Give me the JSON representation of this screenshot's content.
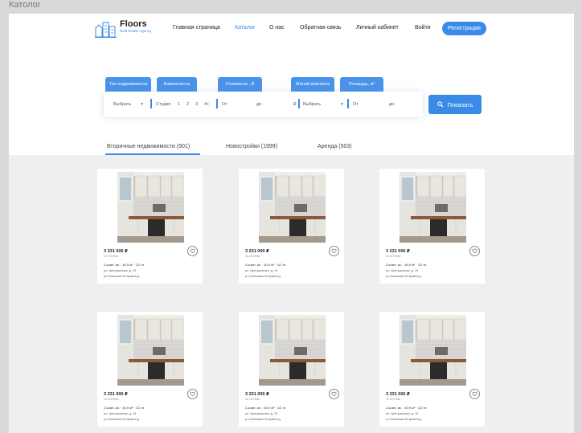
{
  "canvas_label": "Католог",
  "brand": {
    "name": "Floors",
    "tagline": "Real Estate Agency",
    "accent_color": "#3a8be8"
  },
  "nav": {
    "items": [
      "Главная страница",
      "Каталог",
      "О нас",
      "Обратная связь",
      "Личный кабинет",
      "Войти"
    ],
    "active": "Каталог",
    "register_label": "Регистрация"
  },
  "filters": {
    "tabs": [
      "Тип недвижимости",
      "Комнатность",
      "Стоимость , ₽",
      "Жилой комплекс",
      "Площадь, м²"
    ],
    "type_select": "Выбрать",
    "rooms_label": "Студия",
    "rooms_options": [
      "1",
      "2",
      "3",
      "4+"
    ],
    "price_from": "От",
    "price_to": "до",
    "price_unit": "₽",
    "complex_select": "Выбрать",
    "area_from": "От",
    "area_to": "до",
    "submit_label": "Показать"
  },
  "tabs": [
    {
      "label": "Вторичные недвижимости (901)",
      "active": true
    },
    {
      "label": "Новостройки (1999)",
      "active": false
    },
    {
      "label": "Аренда (503)",
      "active": false
    }
  ],
  "listings": [
    {
      "price": "3 231 000 ₽",
      "price_per_m2": "10 223 ₽/м²",
      "rooms": "2-комн. кв.",
      "area": "40,9 м²",
      "floor": "1/2 эт.",
      "address": "ул. Центральная, д. 13",
      "metro": "р-н Большая Островня д."
    },
    {
      "price": "3 231 000 ₽",
      "price_per_m2": "10 223 ₽/м²",
      "rooms": "2-комн. кв.",
      "area": "40,9 м²",
      "floor": "1/2 эт.",
      "address": "ул. Центральная, д. 13",
      "metro": "р-н Большая Островня д."
    },
    {
      "price": "3 231 000 ₽",
      "price_per_m2": "10 223 ₽/м²",
      "rooms": "2-комн. кв.",
      "area": "40,9 м²",
      "floor": "1/2 эт.",
      "address": "ул. Центральная, д. 13",
      "metro": "р-н Большая Островня д."
    },
    {
      "price": "3 231 000 ₽",
      "price_per_m2": "10 223 ₽/м²",
      "rooms": "2-комн. кв.",
      "area": "40,9 м²",
      "floor": "1/2 эт.",
      "address": "ул. Центральная, д. 13",
      "metro": "р-н Большая Островня д."
    },
    {
      "price": "3 231 000 ₽",
      "price_per_m2": "10 223 ₽/м²",
      "rooms": "2-комн. кв.",
      "area": "40,9 м²",
      "floor": "1/2 эт.",
      "address": "ул. Центральная, д. 13",
      "metro": "р-н Большая Островня д."
    },
    {
      "price": "3 231 000 ₽",
      "price_per_m2": "10 223 ₽/м²",
      "rooms": "2-комн. кв.",
      "area": "40,9 м²",
      "floor": "1/2 эт.",
      "address": "ул. Центральная, д. 13",
      "metro": "р-н Большая Островня д."
    }
  ],
  "icons": {
    "search": "search-icon",
    "favorite": "heart-icon",
    "dropdown": "chevron-down-icon",
    "logo": "buildings-icon"
  }
}
